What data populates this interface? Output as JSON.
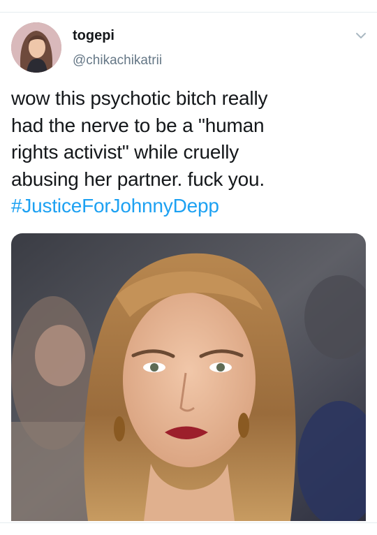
{
  "tweet": {
    "display_name": "togepi",
    "handle": "@chikachikatrii",
    "text_lines": [
      "wow this psychotic bitch really",
      "had the nerve to be a \"human",
      "rights activist\" while cruelly",
      "abusing her partner. fuck you."
    ],
    "hashtag": "#JusticeForJohnnyDepp",
    "menu_icon": "chevron-down-icon",
    "colors": {
      "text": "#14171a",
      "secondary": "#657786",
      "link": "#1da1f2",
      "divider": "#e6ecf0"
    }
  }
}
